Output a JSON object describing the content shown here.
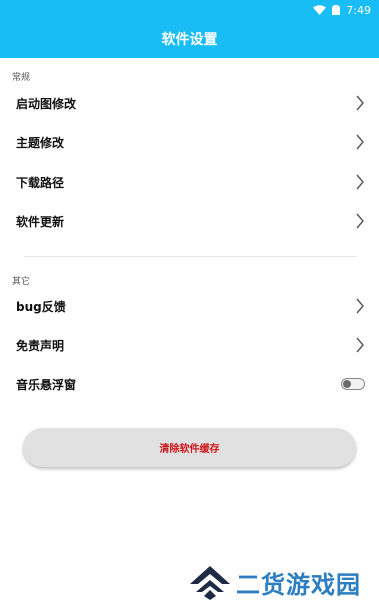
{
  "status_bar": {
    "time": "7:49"
  },
  "header": {
    "title": "软件设置"
  },
  "sections": [
    {
      "header": "常规",
      "items": [
        {
          "label": "启动图修改"
        },
        {
          "label": "主题修改"
        },
        {
          "label": "下载路径"
        },
        {
          "label": "软件更新"
        }
      ]
    },
    {
      "header": "其它",
      "items": [
        {
          "label": "bug反馈"
        },
        {
          "label": "免责声明"
        },
        {
          "label": "音乐悬浮窗",
          "toggle": false
        }
      ]
    }
  ],
  "actions": {
    "clear_cache_label": "清除软件缓存"
  },
  "watermark": {
    "text": "二货游戏园"
  },
  "colors": {
    "accent": "#18bdf5",
    "danger": "#d0171d",
    "watermark": "#2c7ec0"
  }
}
